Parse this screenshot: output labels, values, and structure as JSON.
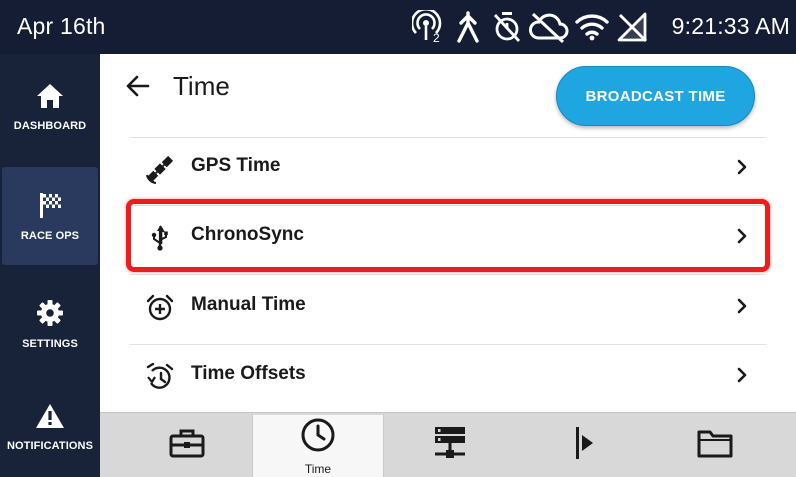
{
  "status_bar": {
    "date": "Apr 16th",
    "time": "9:21:33 AM",
    "icons": [
      "gps-signal-icon",
      "antenna-icon",
      "timer-off-icon",
      "cloud-off-icon",
      "wifi-icon",
      "cellular-off-icon"
    ],
    "gps_badge": "2"
  },
  "sidebar": {
    "items": [
      {
        "label": "DASHBOARD",
        "icon": "home-icon"
      },
      {
        "label": "RACE OPS",
        "icon": "checkered-flag-icon"
      },
      {
        "label": "SETTINGS",
        "icon": "gear-icon"
      },
      {
        "label": "NOTIFICATIONS",
        "icon": "warning-icon"
      }
    ],
    "active": "RACE OPS"
  },
  "header": {
    "title": "Time",
    "broadcast_label": "BROADCAST TIME"
  },
  "menu": {
    "items": [
      {
        "label": "GPS Time",
        "icon": "satellite-icon"
      },
      {
        "label": "ChronoSync",
        "icon": "usb-icon"
      },
      {
        "label": "Manual Time",
        "icon": "alarm-add-icon"
      },
      {
        "label": "Time Offsets",
        "icon": "alarm-history-icon"
      }
    ],
    "highlighted": "ChronoSync"
  },
  "bottom_tabs": {
    "items": [
      {
        "label": "",
        "icon": "briefcase-icon"
      },
      {
        "label": "Time",
        "icon": "clock-icon"
      },
      {
        "label": "",
        "icon": "server-network-icon"
      },
      {
        "label": "",
        "icon": "start-line-flag-icon"
      },
      {
        "label": "",
        "icon": "folder-icon"
      }
    ],
    "active": "Time"
  },
  "colors": {
    "status_bar": "#141d33",
    "sidebar": "#182238",
    "sidebar_active": "#2a3a5e",
    "accent_button": "#1fa6e0",
    "highlight": "#ee1c1c",
    "bottom_bar": "#d8d8d8"
  }
}
